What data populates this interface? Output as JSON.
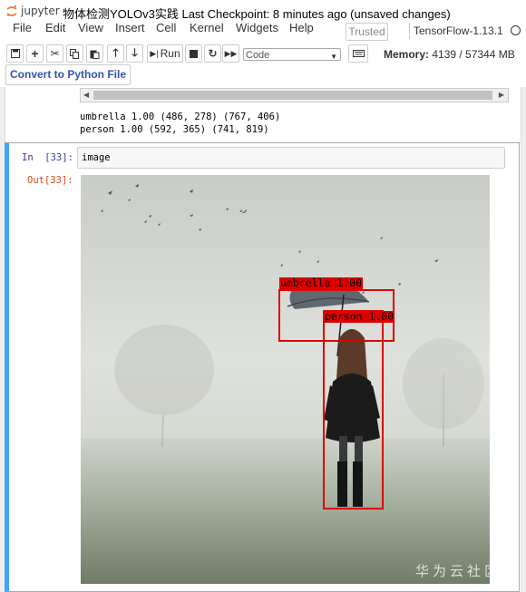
{
  "header": {
    "logo_text": "jupyter",
    "checkpoint_line": "物体检测YOLOv3实践 Last Checkpoint: 8 minutes ago  (unsaved changes)"
  },
  "menu": {
    "items": [
      "File",
      "Edit",
      "View",
      "Insert",
      "Cell",
      "Kernel",
      "Widgets",
      "Help"
    ]
  },
  "trusted_label": "Trusted",
  "kernel_name": "TensorFlow-1.13.1",
  "toolbar": {
    "icons": [
      "save-icon",
      "plus-icon",
      "cut-icon",
      "copy-icon",
      "paste-icon",
      "arrow-up-icon",
      "arrow-down-icon",
      "run-icon",
      "stop-icon",
      "restart-icon",
      "fast-forward-icon",
      "keyboard-icon"
    ],
    "run_label": "Run",
    "cell_type": "Code"
  },
  "memory": {
    "label": "Memory:",
    "value": "4139 / 57344 MB"
  },
  "convert_button": "Convert to Python File",
  "prev_output": {
    "line1": "umbrella 1.00 (486, 278) (767, 406)",
    "line2": "person 1.00 (592, 365) (741, 819)"
  },
  "cell": {
    "in_prompt": "In  [33]:",
    "code": "image",
    "out_prompt": "Out[33]:"
  },
  "detections": [
    {
      "label": "umbrella 1.00"
    },
    {
      "label": "person 1.00"
    }
  ],
  "watermark": "华为云社区"
}
